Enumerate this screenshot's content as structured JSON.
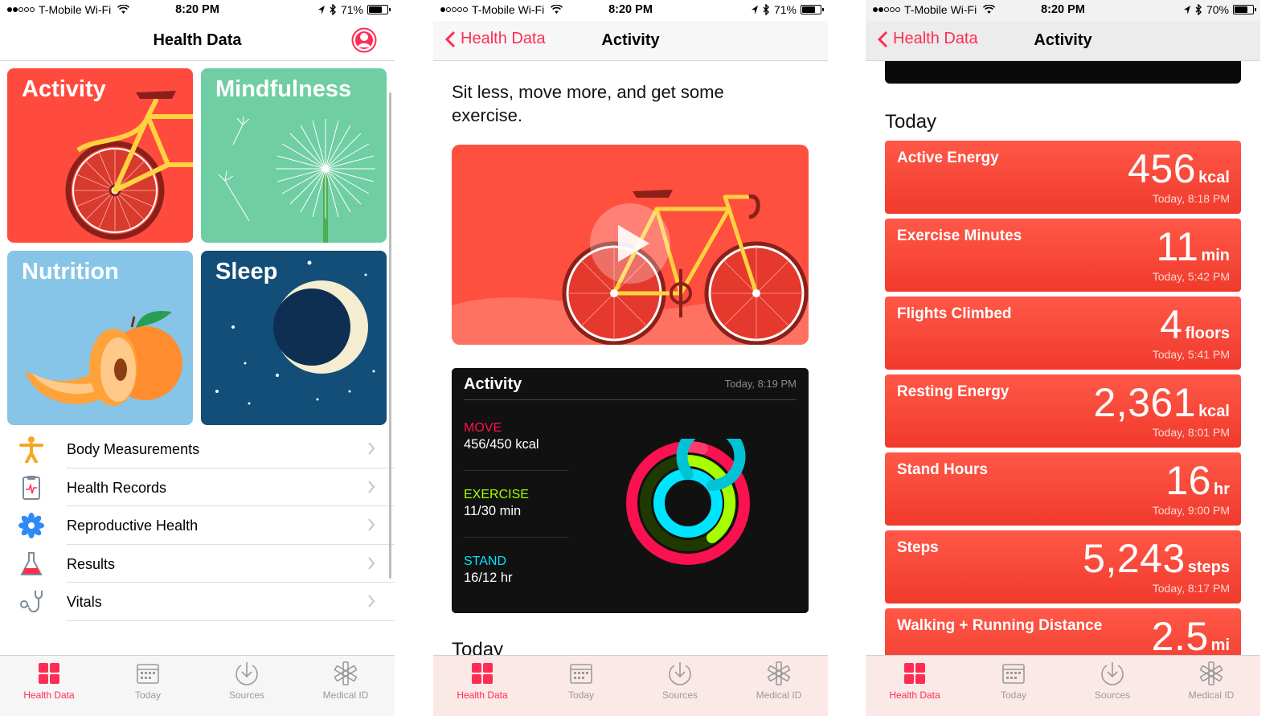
{
  "status_bars": [
    {
      "carrier": "T-Mobile Wi-Fi",
      "time": "8:20 PM",
      "battery": "71%"
    },
    {
      "carrier": "T-Mobile Wi-Fi",
      "time": "8:20 PM",
      "battery": "71%"
    },
    {
      "carrier": "T-Mobile Wi-Fi",
      "time": "8:20 PM",
      "battery": "70%"
    }
  ],
  "screen1": {
    "title": "Health Data",
    "tiles": [
      "Activity",
      "Mindfulness",
      "Nutrition",
      "Sleep"
    ],
    "categories": [
      {
        "label": "Body Measurements",
        "icon": "person-figure-icon"
      },
      {
        "label": "Health Records",
        "icon": "clipboard-heart-icon"
      },
      {
        "label": "Reproductive Health",
        "icon": "flower-icon"
      },
      {
        "label": "Results",
        "icon": "flask-icon"
      },
      {
        "label": "Vitals",
        "icon": "stethoscope-icon"
      }
    ]
  },
  "screen2": {
    "back": "Health Data",
    "title": "Activity",
    "description": "Sit less, move more, and get some exercise.",
    "card": {
      "title": "Activity",
      "timestamp": "Today, 8:19 PM",
      "move_label": "MOVE",
      "move_value": "456/450 kcal",
      "exercise_label": "EXERCISE",
      "exercise_value": "11/30 min",
      "stand_label": "STAND",
      "stand_value": "16/12 hr"
    },
    "section": "Today"
  },
  "screen3": {
    "back": "Health Data",
    "title": "Activity",
    "section": "Today",
    "metrics": [
      {
        "name": "Active Energy",
        "value": "456",
        "unit": "kcal",
        "time": "Today, 8:18 PM"
      },
      {
        "name": "Exercise Minutes",
        "value": "11",
        "unit": "min",
        "time": "Today, 5:42 PM"
      },
      {
        "name": "Flights Climbed",
        "value": "4",
        "unit": "floors",
        "time": "Today, 5:41 PM"
      },
      {
        "name": "Resting Energy",
        "value": "2,361",
        "unit": "kcal",
        "time": "Today, 8:01 PM"
      },
      {
        "name": "Stand Hours",
        "value": "16",
        "unit": "hr",
        "time": "Today, 9:00 PM"
      },
      {
        "name": "Steps",
        "value": "5,243",
        "unit": "steps",
        "time": "Today, 8:17 PM"
      },
      {
        "name": "Walking + Running Distance",
        "value": "2.5",
        "unit": "mi",
        "time": ""
      }
    ]
  },
  "tabbar": [
    "Health Data",
    "Today",
    "Sources",
    "Medical ID"
  ],
  "colors": {
    "accent": "#ff2d55",
    "move": "#fa114f",
    "exercise": "#a6ff00",
    "stand": "#00f0ff",
    "metric_red": "#f5483a"
  }
}
